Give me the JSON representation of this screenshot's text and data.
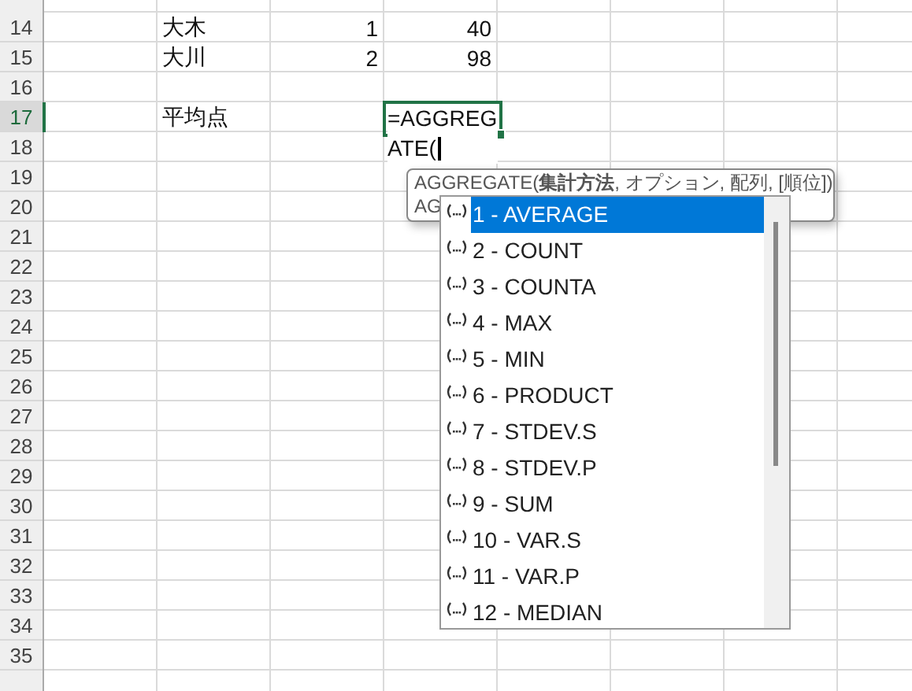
{
  "sheet": {
    "rows": [
      {
        "number": "14",
        "selected": false,
        "column_2": "大木",
        "column_3": "1",
        "column_4": "40"
      },
      {
        "number": "15",
        "selected": false,
        "column_2": "大川",
        "column_3": "2",
        "column_4": "98"
      },
      {
        "number": "16",
        "selected": false
      },
      {
        "number": "17",
        "selected": true,
        "column_2": "平均点"
      },
      {
        "number": "18",
        "selected": false
      },
      {
        "number": "19",
        "selected": false
      },
      {
        "number": "20",
        "selected": false
      },
      {
        "number": "21",
        "selected": false
      },
      {
        "number": "22",
        "selected": false
      },
      {
        "number": "23",
        "selected": false
      },
      {
        "number": "24",
        "selected": false
      },
      {
        "number": "25",
        "selected": false
      },
      {
        "number": "26",
        "selected": false
      },
      {
        "number": "27",
        "selected": false
      },
      {
        "number": "28",
        "selected": false
      },
      {
        "number": "29",
        "selected": false
      },
      {
        "number": "30",
        "selected": false
      },
      {
        "number": "31",
        "selected": false
      },
      {
        "number": "32",
        "selected": false
      },
      {
        "number": "33",
        "selected": false
      },
      {
        "number": "34",
        "selected": false
      },
      {
        "number": "35",
        "selected": false
      }
    ]
  },
  "editor": {
    "lines": [
      "=AGGREG",
      "ATE("
    ]
  },
  "tooltip": {
    "lines": [
      "AGGREGATE(**集計方法**, オプション, 配列, [順位])",
      "AG"
    ]
  },
  "autocomplete": {
    "items": [
      {
        "label": "1 - AVERAGE",
        "selected": true
      },
      {
        "label": "2 - COUNT",
        "selected": false
      },
      {
        "label": "3 - COUNTA",
        "selected": false
      },
      {
        "label": "4 - MAX",
        "selected": false
      },
      {
        "label": "5 - MIN",
        "selected": false
      },
      {
        "label": "6 - PRODUCT",
        "selected": false
      },
      {
        "label": "7 - STDEV.S",
        "selected": false
      },
      {
        "label": "8 - STDEV.P",
        "selected": false
      },
      {
        "label": "9 - SUM",
        "selected": false
      },
      {
        "label": "10 - VAR.S",
        "selected": false
      },
      {
        "label": "11 - VAR.P",
        "selected": false
      },
      {
        "label": "12 - MEDIAN",
        "selected": false
      }
    ]
  }
}
